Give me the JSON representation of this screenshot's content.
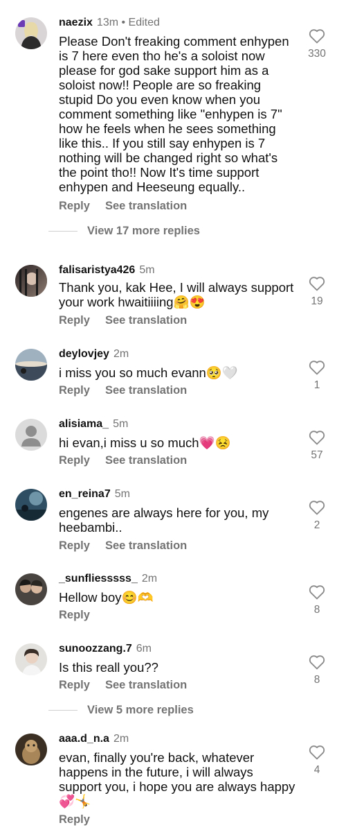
{
  "comments": [
    {
      "username": "naezix",
      "time": "13m",
      "edited": "• Edited",
      "text": "Please Don't freaking comment enhypen is 7 here even tho he's a soloist now please for god sake support him as a soloist now!! People are so freaking stupid Do you even know when you comment something like \"enhypen is 7\" how he feels when he sees something like this.. If you still say enhypen is 7 nothing will be changed right so what's the point tho!! Now It's time support enhypen and Heeseung equally..",
      "reply": "Reply",
      "translate": "See translation",
      "likes": "330",
      "more_replies": "View 17 more replies"
    },
    {
      "username": "falisaristya426",
      "time": "5m",
      "text": "Thank you, kak Hee, I will always support your work hwaitiiiing🤗😍",
      "reply": "Reply",
      "translate": "See translation",
      "likes": "19"
    },
    {
      "username": "deylovjey",
      "time": "2m",
      "text": "i miss you so much evann🥺🤍",
      "reply": "Reply",
      "translate": "See translation",
      "likes": "1"
    },
    {
      "username": "alisiama_",
      "time": "5m",
      "text": "hi evan,i miss u so much💗😣",
      "reply": "Reply",
      "translate": "See translation",
      "likes": "57"
    },
    {
      "username": "en_reina7",
      "time": "5m",
      "text": "engenes are always here for you, my heebambi..",
      "reply": "Reply",
      "translate": "See translation",
      "likes": "2"
    },
    {
      "username": "_sunfliesssss_",
      "time": "2m",
      "text": "Hellow boy😊🫶",
      "reply": "Reply",
      "likes": "8"
    },
    {
      "username": "sunoozzang.7",
      "time": "6m",
      "text": "Is this reall you??",
      "reply": "Reply",
      "translate": "See translation",
      "likes": "8",
      "more_replies": "View 5 more replies"
    },
    {
      "username": "aaa.d_n.a",
      "time": "2m",
      "text": "evan, finally you're back, whatever happens in the future, i will always support you, i hope you are always happy💞🤸",
      "reply": "Reply",
      "likes": "4"
    }
  ],
  "colors": {
    "text": "#111111",
    "muted": "#737373",
    "background": "#ffffff"
  },
  "icons": {
    "like": "heart-outline-icon",
    "default_avatar": "person-silhouette-icon"
  }
}
